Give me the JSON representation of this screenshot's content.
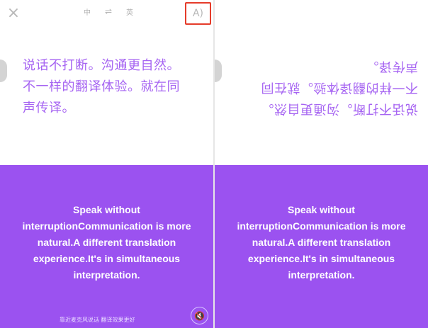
{
  "left_panel": {
    "close_icon": "×",
    "lang_from": "中",
    "lang_swap_icon": "⇌",
    "lang_to": "英",
    "auto_voice_icon": "A)",
    "chinese_text": "说话不打断。沟通更自然。不一样的翻译体验。就在同声传译。",
    "english_text": "Speak without interruptionCommunication is more natural.A different translation experience.It's in simultaneous interpretation.",
    "footer_tip": "靠近麦克风说话 翻译效果更好",
    "mute_icon": "🔇"
  },
  "right_panel": {
    "chinese_text": "说话不打断。沟通更自然。不一样的翻译体验。就在同声传译。",
    "english_text": "Speak without interruptionCommunication is more natural.A different translation experience.It's in simultaneous interpretation."
  },
  "colors": {
    "purple": "#9b52f0",
    "chinese_text": "#a664f2",
    "highlight_border": "#e53c2a"
  },
  "icons": {
    "close": "close-icon",
    "swap": "swap-icon",
    "auto_voice": "auto-voice-icon",
    "mute": "mute-icon"
  }
}
